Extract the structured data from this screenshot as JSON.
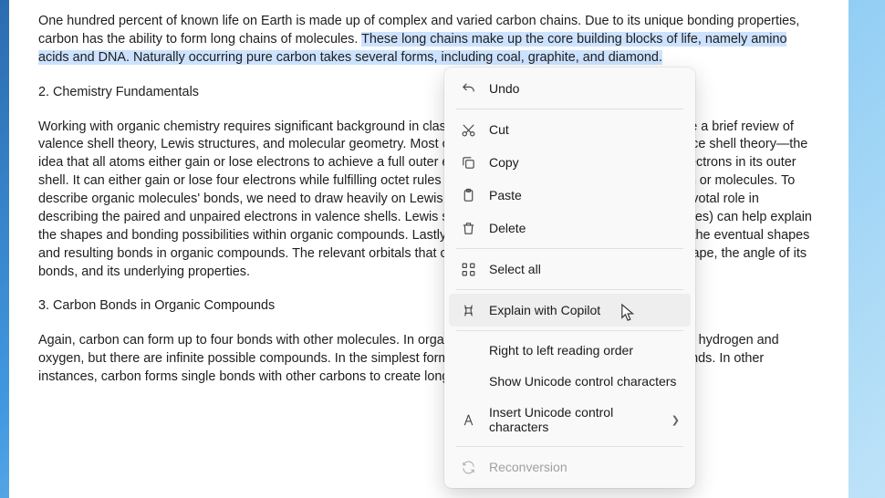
{
  "document": {
    "para1_before_highlight": "One hundred percent of known life on Earth is made up of complex and varied carbon chains. Due to its unique bonding properties, carbon has the ability to form long chains of molecules. ",
    "para1_highlight": "These long chains make up the core building blocks of life, namely amino acids and DNA. Naturally occurring pure carbon takes several forms, including coal, graphite, and diamond.",
    "heading2": "2. Chemistry Fundamentals",
    "para2": "Working with organic chemistry requires significant background in classical chemistry. To aid students, we provide a brief review of valence shell theory, Lewis structures, and molecular geometry. Most of organic chemistry revolves around valence shell theory—the idea that all atoms either gain or lose electrons to achieve a full outer electron shell. This effect due to the four electrons in its outer shell. It can either gain or lose four electrons while fulfilling octet rules and forming atomic bonds with other atoms or molecules. To describe organic molecules' bonds, we need to draw heavily on Lewis dot notation. Lewis dot structures play a pivotal role in describing the paired and unpaired electrons in valence shells. Lewis structures (and examining resonant structures) can help explain the shapes and bonding possibilities within organic compounds. Lastly, electron orbital shells can help illuminate the eventual shapes and resulting bonds in organic compounds. The relevant orbitals that comprise a molecule can tell us its basic shape, the angle of its bonds, and its underlying properties.",
    "heading3": "3. Carbon Bonds in Organic Compounds",
    "para3": "Again, carbon can form up to four bonds with other molecules. In organic chemistry, most of these are bonds with hydrogen and oxygen, but there are infinite possible compounds. In the simplest form, carbon pairs with hydrogen via single bonds. In other instances, carbon forms single bonds with other carbons to create longer chains."
  },
  "menu": {
    "undo": "Undo",
    "cut": "Cut",
    "copy": "Copy",
    "paste": "Paste",
    "delete": "Delete",
    "select_all": "Select all",
    "explain_copilot": "Explain with Copilot",
    "rtl": "Right to left reading order",
    "show_unicode": "Show Unicode control characters",
    "insert_unicode": "Insert Unicode control characters",
    "reconversion": "Reconversion"
  }
}
